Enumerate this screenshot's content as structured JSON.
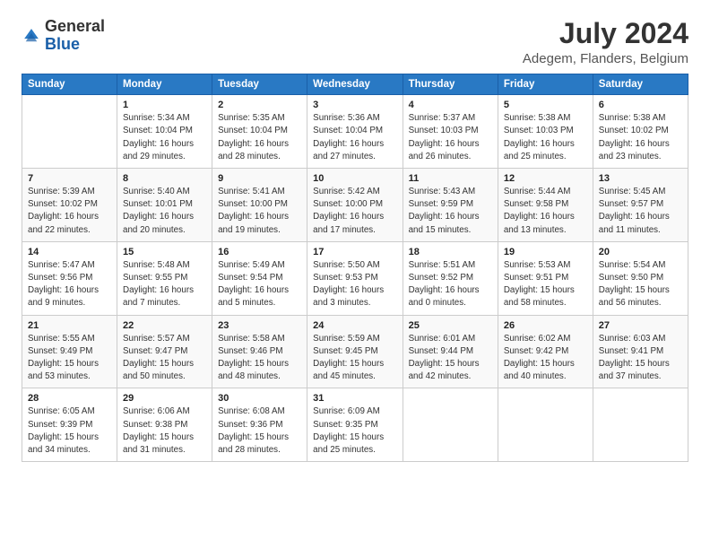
{
  "logo": {
    "general": "General",
    "blue": "Blue"
  },
  "title": "July 2024",
  "subtitle": "Adegem, Flanders, Belgium",
  "header": {
    "days": [
      "Sunday",
      "Monday",
      "Tuesday",
      "Wednesday",
      "Thursday",
      "Friday",
      "Saturday"
    ]
  },
  "weeks": [
    [
      {
        "day": "",
        "info": ""
      },
      {
        "day": "1",
        "info": "Sunrise: 5:34 AM\nSunset: 10:04 PM\nDaylight: 16 hours\nand 29 minutes."
      },
      {
        "day": "2",
        "info": "Sunrise: 5:35 AM\nSunset: 10:04 PM\nDaylight: 16 hours\nand 28 minutes."
      },
      {
        "day": "3",
        "info": "Sunrise: 5:36 AM\nSunset: 10:04 PM\nDaylight: 16 hours\nand 27 minutes."
      },
      {
        "day": "4",
        "info": "Sunrise: 5:37 AM\nSunset: 10:03 PM\nDaylight: 16 hours\nand 26 minutes."
      },
      {
        "day": "5",
        "info": "Sunrise: 5:38 AM\nSunset: 10:03 PM\nDaylight: 16 hours\nand 25 minutes."
      },
      {
        "day": "6",
        "info": "Sunrise: 5:38 AM\nSunset: 10:02 PM\nDaylight: 16 hours\nand 23 minutes."
      }
    ],
    [
      {
        "day": "7",
        "info": "Sunrise: 5:39 AM\nSunset: 10:02 PM\nDaylight: 16 hours\nand 22 minutes."
      },
      {
        "day": "8",
        "info": "Sunrise: 5:40 AM\nSunset: 10:01 PM\nDaylight: 16 hours\nand 20 minutes."
      },
      {
        "day": "9",
        "info": "Sunrise: 5:41 AM\nSunset: 10:00 PM\nDaylight: 16 hours\nand 19 minutes."
      },
      {
        "day": "10",
        "info": "Sunrise: 5:42 AM\nSunset: 10:00 PM\nDaylight: 16 hours\nand 17 minutes."
      },
      {
        "day": "11",
        "info": "Sunrise: 5:43 AM\nSunset: 9:59 PM\nDaylight: 16 hours\nand 15 minutes."
      },
      {
        "day": "12",
        "info": "Sunrise: 5:44 AM\nSunset: 9:58 PM\nDaylight: 16 hours\nand 13 minutes."
      },
      {
        "day": "13",
        "info": "Sunrise: 5:45 AM\nSunset: 9:57 PM\nDaylight: 16 hours\nand 11 minutes."
      }
    ],
    [
      {
        "day": "14",
        "info": "Sunrise: 5:47 AM\nSunset: 9:56 PM\nDaylight: 16 hours\nand 9 minutes."
      },
      {
        "day": "15",
        "info": "Sunrise: 5:48 AM\nSunset: 9:55 PM\nDaylight: 16 hours\nand 7 minutes."
      },
      {
        "day": "16",
        "info": "Sunrise: 5:49 AM\nSunset: 9:54 PM\nDaylight: 16 hours\nand 5 minutes."
      },
      {
        "day": "17",
        "info": "Sunrise: 5:50 AM\nSunset: 9:53 PM\nDaylight: 16 hours\nand 3 minutes."
      },
      {
        "day": "18",
        "info": "Sunrise: 5:51 AM\nSunset: 9:52 PM\nDaylight: 16 hours\nand 0 minutes."
      },
      {
        "day": "19",
        "info": "Sunrise: 5:53 AM\nSunset: 9:51 PM\nDaylight: 15 hours\nand 58 minutes."
      },
      {
        "day": "20",
        "info": "Sunrise: 5:54 AM\nSunset: 9:50 PM\nDaylight: 15 hours\nand 56 minutes."
      }
    ],
    [
      {
        "day": "21",
        "info": "Sunrise: 5:55 AM\nSunset: 9:49 PM\nDaylight: 15 hours\nand 53 minutes."
      },
      {
        "day": "22",
        "info": "Sunrise: 5:57 AM\nSunset: 9:47 PM\nDaylight: 15 hours\nand 50 minutes."
      },
      {
        "day": "23",
        "info": "Sunrise: 5:58 AM\nSunset: 9:46 PM\nDaylight: 15 hours\nand 48 minutes."
      },
      {
        "day": "24",
        "info": "Sunrise: 5:59 AM\nSunset: 9:45 PM\nDaylight: 15 hours\nand 45 minutes."
      },
      {
        "day": "25",
        "info": "Sunrise: 6:01 AM\nSunset: 9:44 PM\nDaylight: 15 hours\nand 42 minutes."
      },
      {
        "day": "26",
        "info": "Sunrise: 6:02 AM\nSunset: 9:42 PM\nDaylight: 15 hours\nand 40 minutes."
      },
      {
        "day": "27",
        "info": "Sunrise: 6:03 AM\nSunset: 9:41 PM\nDaylight: 15 hours\nand 37 minutes."
      }
    ],
    [
      {
        "day": "28",
        "info": "Sunrise: 6:05 AM\nSunset: 9:39 PM\nDaylight: 15 hours\nand 34 minutes."
      },
      {
        "day": "29",
        "info": "Sunrise: 6:06 AM\nSunset: 9:38 PM\nDaylight: 15 hours\nand 31 minutes."
      },
      {
        "day": "30",
        "info": "Sunrise: 6:08 AM\nSunset: 9:36 PM\nDaylight: 15 hours\nand 28 minutes."
      },
      {
        "day": "31",
        "info": "Sunrise: 6:09 AM\nSunset: 9:35 PM\nDaylight: 15 hours\nand 25 minutes."
      },
      {
        "day": "",
        "info": ""
      },
      {
        "day": "",
        "info": ""
      },
      {
        "day": "",
        "info": ""
      }
    ]
  ]
}
